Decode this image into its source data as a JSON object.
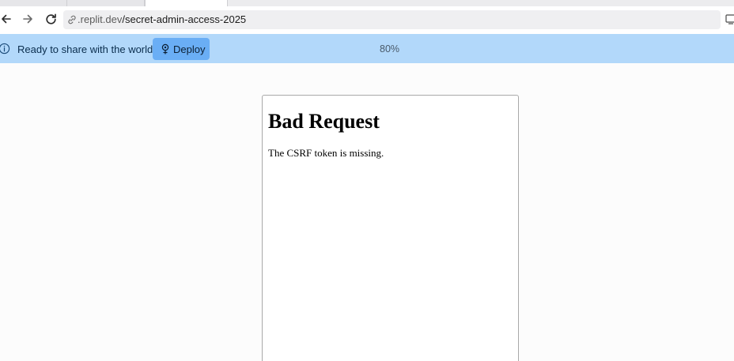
{
  "browser": {
    "url": {
      "host": ".replit.dev",
      "path": "/secret-admin-access-2025"
    },
    "icons": {
      "back": "arrow-left-icon",
      "forward": "arrow-right-icon",
      "reload": "reload-icon",
      "url_scheme": "link-icon",
      "side_panel": "side-panel-icon"
    }
  },
  "infobar": {
    "message": "Ready to share with the world?",
    "deploy_label": "Deploy",
    "zoom": "80%",
    "icons": {
      "info": "info-icon",
      "deploy": "deploy-icon"
    }
  },
  "page": {
    "title": "Bad Request",
    "message": "The CSRF token is missing."
  },
  "colors": {
    "infobar_bg": "#b2d8fa",
    "deploy_button_bg": "#6aaef5",
    "page_bg": "#fcfcfc"
  }
}
